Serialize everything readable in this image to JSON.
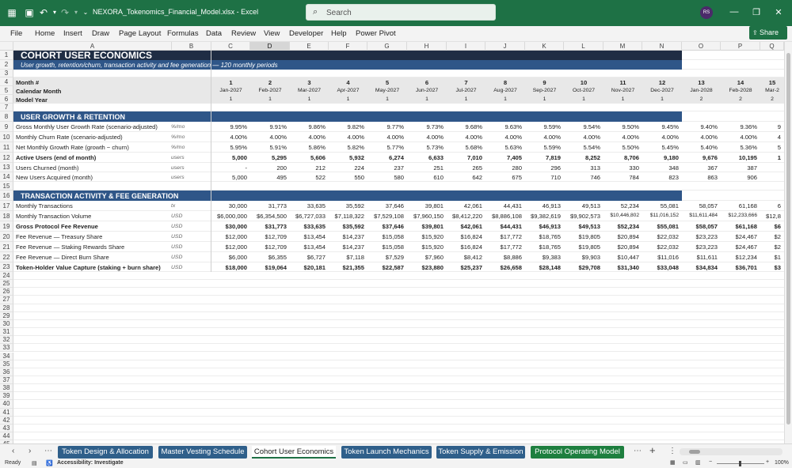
{
  "window": {
    "title": "NEXORA_Tokenomics_Financial_Model.xlsx  -  Excel",
    "search_placeholder": "Search",
    "user_initials": "RS"
  },
  "menu": [
    "File",
    "Home",
    "Insert",
    "Draw",
    "Page Layout",
    "Formulas",
    "Data",
    "Review",
    "View",
    "Developer",
    "Help",
    "Power Pivot"
  ],
  "share_label": "Share",
  "columns": [
    "A",
    "B",
    "C",
    "D",
    "E",
    "F",
    "G",
    "H",
    "I",
    "J",
    "K",
    "L",
    "M",
    "N",
    "O",
    "P",
    "Q"
  ],
  "rows": [
    "1",
    "2",
    "3",
    "4",
    "5",
    "6",
    "7",
    "8",
    "9",
    "10",
    "11",
    "12",
    "13",
    "14",
    "15",
    "16",
    "17",
    "18",
    "19",
    "20",
    "21",
    "22",
    "23",
    "24",
    "25",
    "26",
    "27",
    "28",
    "29",
    "30",
    "31",
    "32",
    "33",
    "34",
    "35",
    "36",
    "37",
    "38",
    "39",
    "40",
    "41",
    "42",
    "43",
    "44",
    "45",
    "46",
    "47",
    "48",
    "49"
  ],
  "sheet": {
    "title": "COHORT USER ECONOMICS",
    "subtitle": "User growth, retention/churn, transaction activity and fee generation — 120 monthly periods",
    "header": {
      "month_label": "Month #",
      "cal_label": "Calendar Month",
      "year_label": "Model Year",
      "months": [
        "1",
        "2",
        "3",
        "4",
        "5",
        "6",
        "7",
        "8",
        "9",
        "10",
        "11",
        "12",
        "13",
        "14",
        "15"
      ],
      "dates": [
        "Jan-2027",
        "Feb-2027",
        "Mar-2027",
        "Apr-2027",
        "May-2027",
        "Jun-2027",
        "Jul-2027",
        "Aug-2027",
        "Sep-2027",
        "Oct-2027",
        "Nov-2027",
        "Dec-2027",
        "Jan-2028",
        "Feb-2028",
        "Mar-2"
      ],
      "years": [
        "1",
        "1",
        "1",
        "1",
        "1",
        "1",
        "1",
        "1",
        "1",
        "1",
        "1",
        "1",
        "2",
        "2",
        "2"
      ]
    },
    "section1": "USER GROWTH & RETENTION",
    "section2": "TRANSACTION ACTIVITY & FEE GENERATION",
    "growth_rows": [
      {
        "label": "Gross Monthly User Growth Rate (scenario-adjusted)",
        "unit": "%/mo",
        "bold": false,
        "values": [
          "9.95%",
          "9.91%",
          "9.86%",
          "9.82%",
          "9.77%",
          "9.73%",
          "9.68%",
          "9.63%",
          "9.59%",
          "9.54%",
          "9.50%",
          "9.45%",
          "9.40%",
          "9.36%",
          "9"
        ]
      },
      {
        "label": "Monthly Churn Rate (scenario-adjusted)",
        "unit": "%/mo",
        "bold": false,
        "values": [
          "4.00%",
          "4.00%",
          "4.00%",
          "4.00%",
          "4.00%",
          "4.00%",
          "4.00%",
          "4.00%",
          "4.00%",
          "4.00%",
          "4.00%",
          "4.00%",
          "4.00%",
          "4.00%",
          "4"
        ]
      },
      {
        "label": "Net Monthly Growth Rate (growth − churn)",
        "unit": "%/mo",
        "bold": false,
        "values": [
          "5.95%",
          "5.91%",
          "5.86%",
          "5.82%",
          "5.77%",
          "5.73%",
          "5.68%",
          "5.63%",
          "5.59%",
          "5.54%",
          "5.50%",
          "5.45%",
          "5.40%",
          "5.36%",
          "5"
        ]
      },
      {
        "label": "Active Users (end of month)",
        "unit": "users",
        "bold": true,
        "values": [
          "5,000",
          "5,295",
          "5,606",
          "5,932",
          "6,274",
          "6,633",
          "7,010",
          "7,405",
          "7,819",
          "8,252",
          "8,706",
          "9,180",
          "9,676",
          "10,195",
          "1"
        ]
      },
      {
        "label": "Users Churned (month)",
        "unit": "users",
        "bold": false,
        "values": [
          "-",
          "200",
          "212",
          "224",
          "237",
          "251",
          "265",
          "280",
          "296",
          "313",
          "330",
          "348",
          "367",
          "387",
          ""
        ]
      },
      {
        "label": "New Users Acquired (month)",
        "unit": "users",
        "bold": false,
        "values": [
          "5,000",
          "495",
          "522",
          "550",
          "580",
          "610",
          "642",
          "675",
          "710",
          "746",
          "784",
          "823",
          "863",
          "906",
          ""
        ]
      }
    ],
    "fee_rows": [
      {
        "label": "Monthly Transactions",
        "unit": "tx",
        "bold": false,
        "values": [
          "30,000",
          "31,773",
          "33,635",
          "35,592",
          "37,646",
          "39,801",
          "42,061",
          "44,431",
          "46,913",
          "49,513",
          "52,234",
          "55,081",
          "58,057",
          "61,168",
          "6"
        ]
      },
      {
        "label": "Monthly Transaction Volume",
        "unit": "USD",
        "bold": false,
        "values": [
          "$6,000,000",
          "$6,354,500",
          "$6,727,033",
          "$7,118,322",
          "$7,529,108",
          "$7,960,150",
          "$8,412,220",
          "$8,886,108",
          "$9,382,619",
          "$9,902,573",
          "$10,446,802",
          "$11,016,152",
          "$11,611,484",
          "$12,233,666",
          "$12,8"
        ]
      },
      {
        "label": "Gross Protocol Fee Revenue",
        "unit": "USD",
        "bold": true,
        "values": [
          "$30,000",
          "$31,773",
          "$33,635",
          "$35,592",
          "$37,646",
          "$39,801",
          "$42,061",
          "$44,431",
          "$46,913",
          "$49,513",
          "$52,234",
          "$55,081",
          "$58,057",
          "$61,168",
          "$6"
        ]
      },
      {
        "label": "Fee Revenue — Treasury Share",
        "unit": "USD",
        "bold": false,
        "values": [
          "$12,000",
          "$12,709",
          "$13,454",
          "$14,237",
          "$15,058",
          "$15,920",
          "$16,824",
          "$17,772",
          "$18,765",
          "$19,805",
          "$20,894",
          "$22,032",
          "$23,223",
          "$24,467",
          "$2"
        ]
      },
      {
        "label": "Fee Revenue — Staking Rewards Share",
        "unit": "USD",
        "bold": false,
        "values": [
          "$12,000",
          "$12,709",
          "$13,454",
          "$14,237",
          "$15,058",
          "$15,920",
          "$16,824",
          "$17,772",
          "$18,765",
          "$19,805",
          "$20,894",
          "$22,032",
          "$23,223",
          "$24,467",
          "$2"
        ]
      },
      {
        "label": "Fee Revenue — Direct Burn Share",
        "unit": "USD",
        "bold": false,
        "values": [
          "$6,000",
          "$6,355",
          "$6,727",
          "$7,118",
          "$7,529",
          "$7,960",
          "$8,412",
          "$8,886",
          "$9,383",
          "$9,903",
          "$10,447",
          "$11,016",
          "$11,611",
          "$12,234",
          "$1"
        ]
      },
      {
        "label": "Token-Holder Value Capture (staking + burn share)",
        "unit": "USD",
        "bold": true,
        "values": [
          "$18,000",
          "$19,064",
          "$20,181",
          "$21,355",
          "$22,587",
          "$23,880",
          "$25,237",
          "$26,658",
          "$28,148",
          "$29,708",
          "$31,340",
          "$33,048",
          "$34,834",
          "$36,701",
          "$3"
        ]
      }
    ]
  },
  "tabs": [
    {
      "label": "Token Design & Allocation",
      "color": "#2f5f8a",
      "active": false
    },
    {
      "label": "Master Vesting Schedule",
      "color": "#2f5f8a",
      "active": false
    },
    {
      "label": "Cohort User Economics",
      "color": "#2f5f8a",
      "active": true
    },
    {
      "label": "Token Launch Mechanics",
      "color": "#2f5f8a",
      "active": false
    },
    {
      "label": "Token Supply & Emission",
      "color": "#2f5f8a",
      "active": false
    },
    {
      "label": "Protocol Operating Model",
      "color": "#1e7f3f",
      "active": false
    }
  ],
  "status": {
    "ready": "Ready",
    "accessibility": "Accessibility: Investigate",
    "zoom": "100%"
  },
  "colors": {
    "excel_green": "#1e7145",
    "title_band": "#1f2d44",
    "section_band": "#2f5688",
    "subtitle_band": "#2f5688",
    "header_gray": "#e8e8e8"
  }
}
